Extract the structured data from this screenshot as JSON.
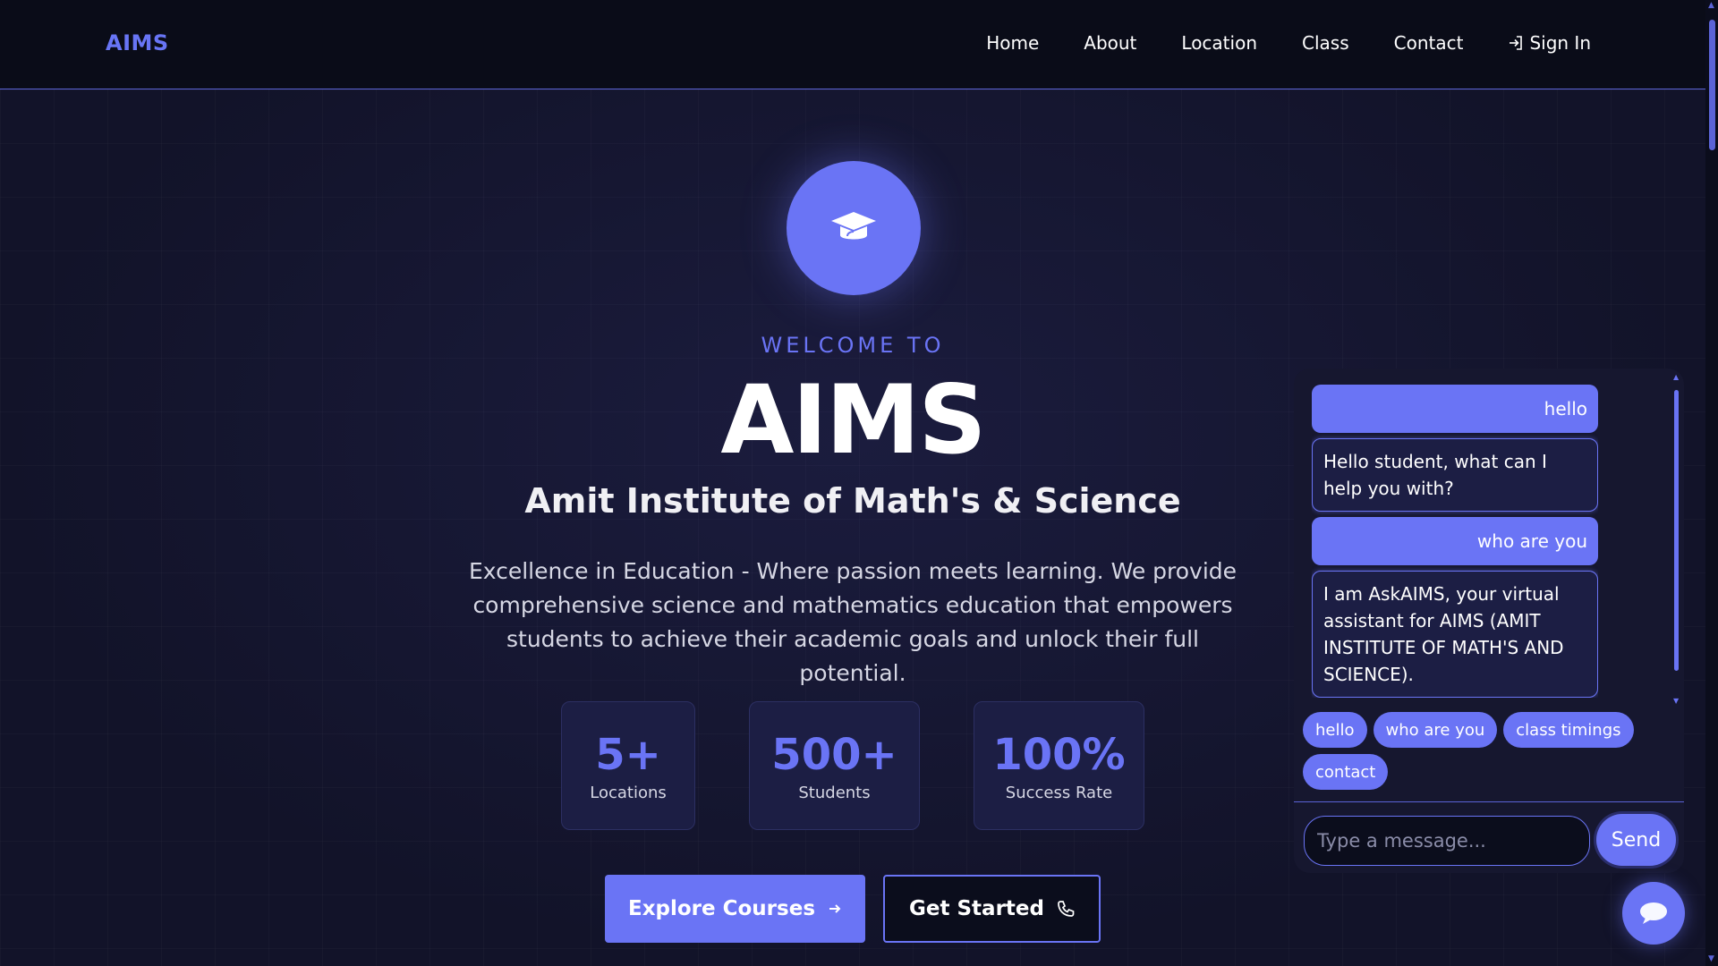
{
  "navbar": {
    "brand": "AIMS",
    "links": [
      "Home",
      "About",
      "Location",
      "Class",
      "Contact"
    ],
    "signin_label": "Sign In"
  },
  "hero": {
    "welcome": "WELCOME TO",
    "title": "AIMS",
    "subtitle": "Amit Institute of Math's & Science",
    "description": "Excellence in Education - Where passion meets learning. We provide comprehensive science and mathematics education that empowers students to achieve their academic goals and unlock their full potential.",
    "stats": [
      {
        "value": "5+",
        "label": "Locations"
      },
      {
        "value": "500+",
        "label": "Students"
      },
      {
        "value": "100%",
        "label": "Success Rate"
      }
    ],
    "primary_cta": "Explore Courses",
    "secondary_cta": "Get Started"
  },
  "chat": {
    "messages": [
      {
        "role": "user",
        "text": "hello"
      },
      {
        "role": "bot",
        "text": "Hello student, what can I help you with?"
      },
      {
        "role": "user",
        "text": "who are you"
      },
      {
        "role": "bot",
        "text": "I am AskAIMS, your virtual assistant for AIMS (AMIT INSTITUTE OF MATH'S AND SCIENCE)."
      }
    ],
    "quick_replies": [
      "hello",
      "who are you",
      "class timings",
      "contact"
    ],
    "input_placeholder": "Type a message...",
    "send_label": "Send"
  },
  "colors": {
    "accent": "#6a74f5",
    "background": "#0b0d1c",
    "card": "#1c1e44"
  }
}
